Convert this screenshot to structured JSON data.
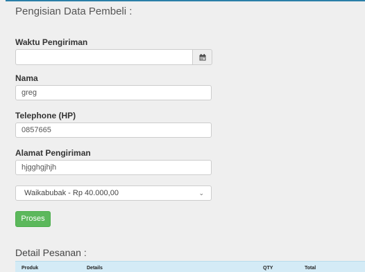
{
  "form": {
    "title": "Pengisian Data Pembeli :",
    "waktu": {
      "label": "Waktu Pengiriman",
      "value": ""
    },
    "nama": {
      "label": "Nama",
      "value": "greg"
    },
    "telephone": {
      "label": "Telephone (HP)",
      "value": "0857665"
    },
    "alamat": {
      "label": "Alamat Pengiriman",
      "value": "hjgghgjhjh"
    },
    "shipping_select": {
      "value": "Waikabubak - Rp 40.000,00"
    },
    "submit_label": "Proses"
  },
  "detail": {
    "title": "Detail Pesanan :",
    "columns": [
      "Produk",
      "Details",
      "QTY",
      "Total"
    ]
  },
  "icons": {
    "calendar": "calendar-icon",
    "dropdown": "chevron-down-icon"
  },
  "colors": {
    "accent_line": "#2a7fa8",
    "button_success": "#5cb85c",
    "table_header_bg": "#d4ebf6"
  }
}
